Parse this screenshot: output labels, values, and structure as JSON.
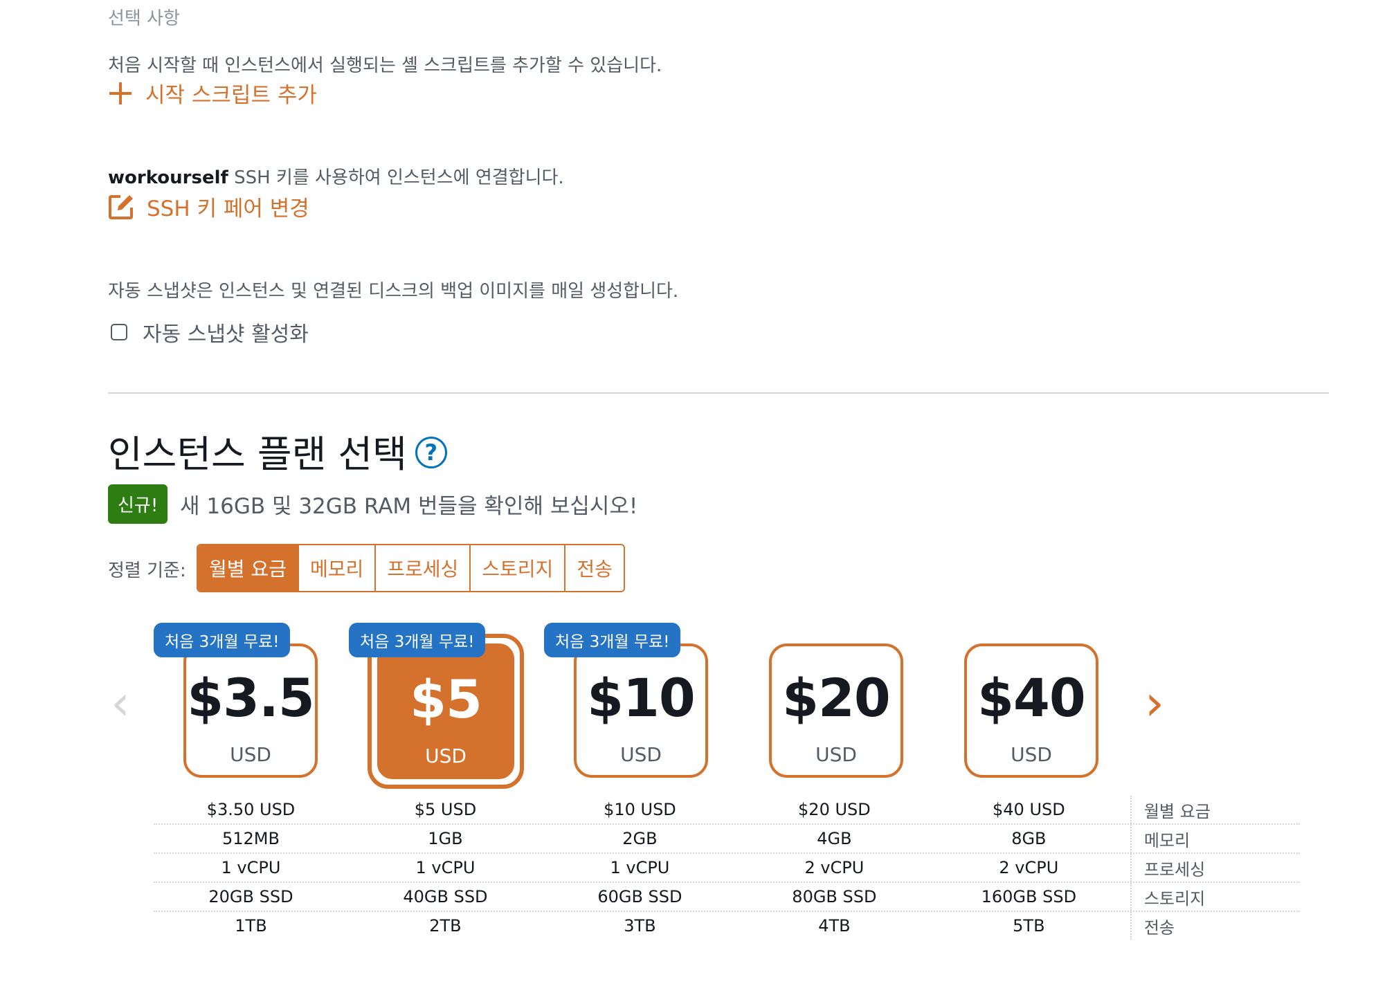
{
  "optional_label": "선택 사항",
  "launch_script": {
    "description": "처음 시작할 때 인스턴스에서 실행되는 셸 스크립트를 추가할 수 있습니다.",
    "add_label": "시작 스크립트 추가"
  },
  "ssh": {
    "key_name": "workourself",
    "description": " SSH 키를 사용하여 인스턴스에 연결합니다.",
    "change_label": "SSH 키 페어 변경"
  },
  "snapshot": {
    "description": "자동 스냅샷은 인스턴스 및 연결된 디스크의 백업 이미지를 매일 생성합니다.",
    "checkbox_label": "자동 스냅샷 활성화",
    "checked": false
  },
  "plan": {
    "title": "인스턴스 플랜 선택",
    "help_glyph": "?",
    "new_badge": "신규!",
    "new_text": "새 16GB 및 32GB RAM 번들을 확인해 보십시오!",
    "sort_label": "정렬 기준:",
    "sort_tabs": [
      "월별 요금",
      "메모리",
      "프로세싱",
      "스토리지",
      "전송"
    ],
    "active_sort": 0,
    "prev_arrow": "‹",
    "next_arrow": "›",
    "cards": [
      {
        "price": "$3.5",
        "currency": "USD",
        "promo": "처음 3개월 무료!",
        "selected": false
      },
      {
        "price": "$5",
        "currency": "USD",
        "promo": "처음 3개월 무료!",
        "selected": true
      },
      {
        "price": "$10",
        "currency": "USD",
        "promo": "처음 3개월 무료!",
        "selected": false
      },
      {
        "price": "$20",
        "currency": "USD",
        "promo": "",
        "selected": false
      },
      {
        "price": "$40",
        "currency": "USD",
        "promo": "",
        "selected": false
      }
    ],
    "spec_labels": [
      "월별 요금",
      "메모리",
      "프로세싱",
      "스토리지",
      "전송"
    ],
    "specs": [
      [
        "$3.50 USD",
        "$5 USD",
        "$10 USD",
        "$20 USD",
        "$40 USD"
      ],
      [
        "512MB",
        "1GB",
        "2GB",
        "4GB",
        "8GB"
      ],
      [
        "1 vCPU",
        "1 vCPU",
        "1 vCPU",
        "2 vCPU",
        "2 vCPU"
      ],
      [
        "20GB SSD",
        "40GB SSD",
        "60GB SSD",
        "80GB SSD",
        "160GB SSD"
      ],
      [
        "1TB",
        "2TB",
        "3TB",
        "4TB",
        "5TB"
      ]
    ]
  },
  "colors": {
    "accent": "#d4722d",
    "promo": "#2573c4",
    "new_badge": "#2e7d12",
    "help": "#0073bb"
  }
}
